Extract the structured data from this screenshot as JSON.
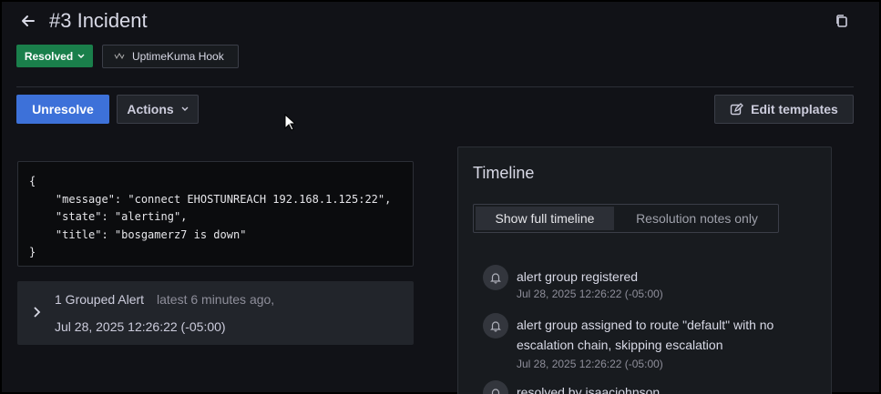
{
  "header": {
    "title": "#3 Incident",
    "status_label": "Resolved",
    "integration_label": "UptimeKuma Hook"
  },
  "toolbar": {
    "unresolve_label": "Unresolve",
    "actions_label": "Actions",
    "edit_templates_label": "Edit templates"
  },
  "payload": {
    "lines": [
      "{",
      "    \"message\": \"connect EHOSTUNREACH 192.168.1.125:22\",",
      "    \"state\": \"alerting\",",
      "    \"title\": \"bosgamerz7 is down\"",
      "}"
    ]
  },
  "grouped_alerts": {
    "count_label": "1 Grouped Alert",
    "latest_label": "latest 6 minutes ago,",
    "date_label": "Jul 28, 2025 12:26:22 (-05:00)"
  },
  "timeline": {
    "title": "Timeline",
    "tabs": [
      "Show full timeline",
      "Resolution notes only"
    ],
    "events": [
      {
        "text": "alert group registered",
        "time": "Jul 28, 2025 12:26:22 (-05:00)"
      },
      {
        "text": "alert group assigned to route \"default\" with no escalation chain, skipping escalation",
        "time": "Jul 28, 2025 12:26:22 (-05:00)"
      },
      {
        "text": "resolved by isaacjohnson",
        "time": ""
      }
    ]
  },
  "colors": {
    "accent": "#3d71d9",
    "resolved": "#1a7f4b",
    "background": "#111217"
  }
}
